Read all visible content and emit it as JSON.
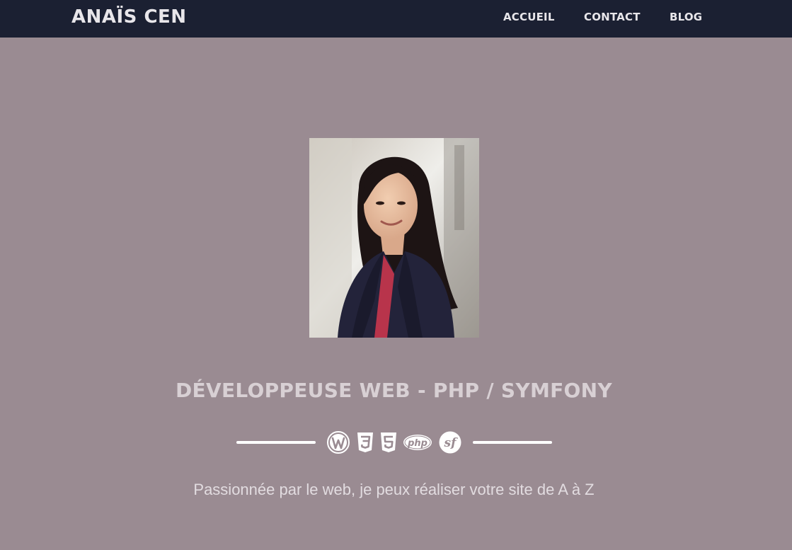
{
  "nav": {
    "brand": "ANAÏS CEN",
    "links": [
      {
        "label": "ACCUEIL"
      },
      {
        "label": "CONTACT"
      },
      {
        "label": "BLOG"
      }
    ]
  },
  "hero": {
    "headline": "DÉVELOPPEUSE WEB - PHP / SYMFONY",
    "tech_icons": [
      "wordpress-icon",
      "css3-icon",
      "html5-icon",
      "php-icon",
      "symfony-icon"
    ],
    "php_label": "php",
    "symfony_label": "sf",
    "tagline": "Passionnée par le web, je peux réaliser votre site de A à Z"
  },
  "colors": {
    "navbar": "#1b2032",
    "background": "#9a8b92",
    "headline": "#d8d0d4",
    "icons": "#ffffff"
  }
}
